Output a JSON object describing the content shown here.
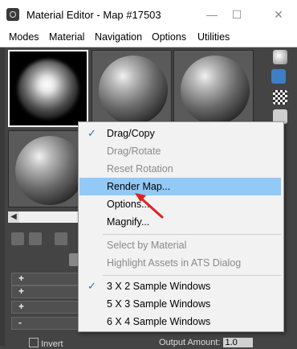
{
  "window": {
    "title": "Material Editor - Map #17503",
    "min_glyph": "—",
    "max_glyph": "☐",
    "close_glyph": "✕"
  },
  "menubar": [
    "Modes",
    "Material",
    "Navigation",
    "Options",
    "Utilities"
  ],
  "context_menu": {
    "items": [
      {
        "label": "Drag/Copy",
        "enabled": true,
        "checked": true
      },
      {
        "label": "Drag/Rotate",
        "enabled": false
      },
      {
        "label": "Reset Rotation",
        "enabled": false
      },
      {
        "label": "Render Map...",
        "enabled": true,
        "highlighted": true
      },
      {
        "label": "Options...",
        "enabled": true
      },
      {
        "label": "Magnify...",
        "enabled": true
      },
      {
        "label": "Select by Material",
        "enabled": false
      },
      {
        "label": "Highlight Assets in ATS Dialog",
        "enabled": false
      },
      {
        "label": "3 X 2 Sample Windows",
        "enabled": true,
        "checked": true
      },
      {
        "label": "5 X 3 Sample Windows",
        "enabled": true
      },
      {
        "label": "6 X 4 Sample Windows",
        "enabled": true
      }
    ]
  },
  "bottom": {
    "invert_label": "Invert",
    "output_amount_label": "Output Amount:",
    "output_amount_value": "1.0"
  },
  "rollouts": [
    "+",
    "+",
    "+",
    "-"
  ],
  "icons": {
    "check": "✓",
    "scroll_left": "◀",
    "annotation_arrow_color": "#e02020"
  }
}
